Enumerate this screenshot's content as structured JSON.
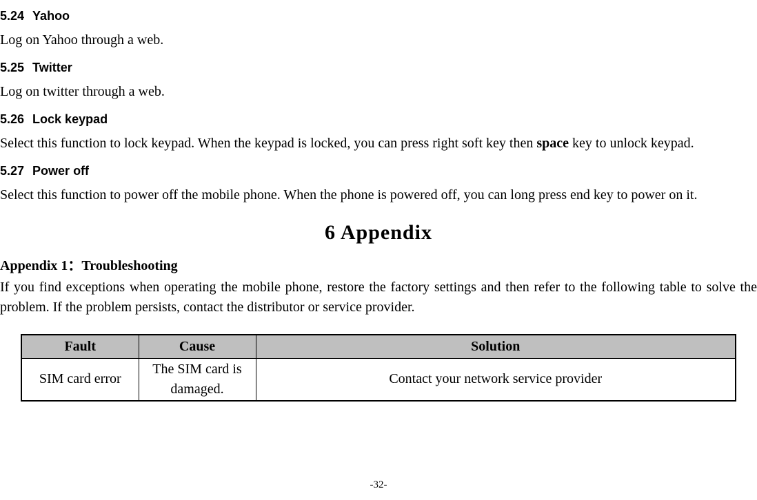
{
  "sections": {
    "s524": {
      "num": "5.24",
      "title": "Yahoo",
      "body": "Log on Yahoo through a web."
    },
    "s525": {
      "num": "5.25",
      "title": "Twitter",
      "body": "Log on twitter through a web."
    },
    "s526": {
      "num": "5.26",
      "title": "Lock keypad",
      "body_prefix": "Select this function to lock keypad. When the keypad is locked, you can press right soft key then ",
      "body_bold": "space",
      "body_suffix": " key to unlock keypad."
    },
    "s527": {
      "num": "5.27",
      "title": "Power off",
      "body": "Select this function to power off the mobile phone. When the phone is powered off, you can long press end key to power on it."
    }
  },
  "appendix": {
    "chapter": "6  Appendix",
    "subtitle": "Appendix 1：Troubleshooting",
    "intro": "If you find exceptions when operating the mobile phone, restore the factory settings and then refer to the following table to solve the problem. If the problem persists, contact the distributor or service provider."
  },
  "table": {
    "headers": {
      "fault": "Fault",
      "cause": "Cause",
      "solution": "Solution"
    },
    "rows": [
      {
        "fault": "SIM card error",
        "cause": "The SIM card is damaged.",
        "solution": "Contact your network service provider"
      }
    ]
  },
  "page_number": "-32-"
}
